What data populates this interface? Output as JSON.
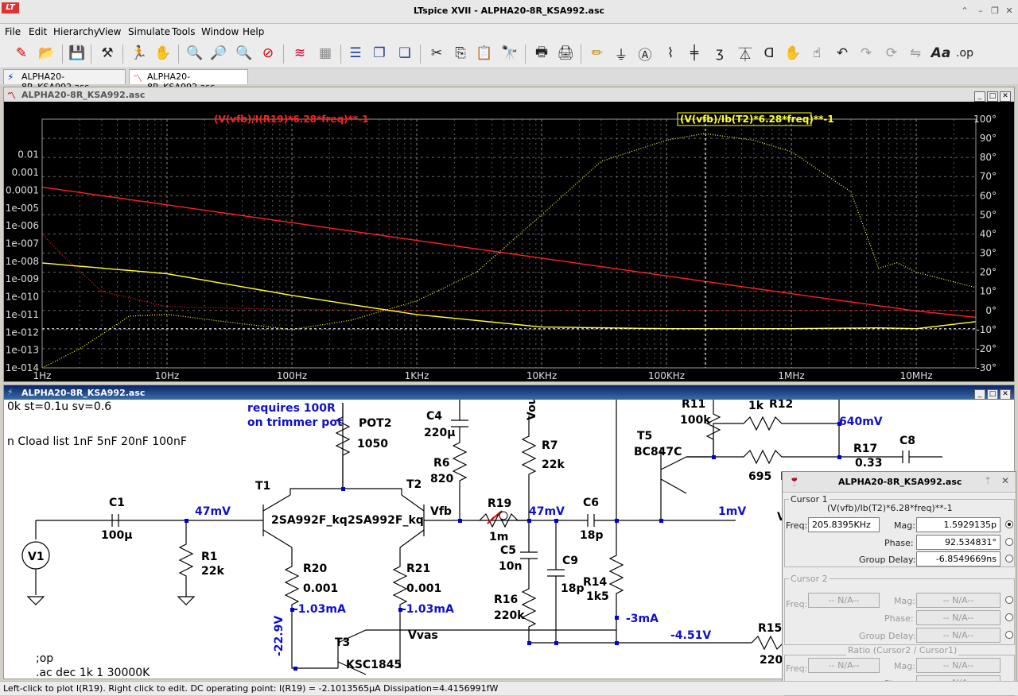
{
  "app": {
    "window_title": "LTspice XVII - ALPHA20-8R_KSA992.asc",
    "logo_text": "LT"
  },
  "menu": [
    "File",
    "Edit",
    "Hierarchy",
    "View",
    "Simulate",
    "Tools",
    "Window",
    "Help"
  ],
  "tabs": [
    {
      "label": "ALPHA20-8R_KSA992.asc",
      "icon": "schematic-icon"
    },
    {
      "label": "ALPHA20-8R_KSA992.asc",
      "icon": "waveform-icon"
    }
  ],
  "plot_window": {
    "title": "ALPHA20-8R_KSA992.asc",
    "trace1_label": "(V(vfb)/I(R19)*6.28*freq)**-1",
    "trace2_label": "(V(vfb)/Ib(T2)*6.28*freq)**-1",
    "trace1_color": "#ff2020",
    "trace2_color": "#ffff30"
  },
  "chart_data": {
    "type": "line",
    "title": "",
    "xscale": "log",
    "xlim": [
      1,
      30000000
    ],
    "xticks": [
      "1Hz",
      "10Hz",
      "100Hz",
      "1KHz",
      "10KHz",
      "100KHz",
      "1MHz",
      "10MHz"
    ],
    "yscale": "log",
    "ylim": [
      1e-14,
      1
    ],
    "yticks_left": [
      "0.01",
      "0.001",
      "0.0001",
      "1e-005",
      "1e-006",
      "1e-007",
      "1e-008",
      "1e-009",
      "1e-010",
      "1e-011",
      "1e-012",
      "1e-013",
      "1e-014"
    ],
    "yticks_left_values": [
      0.01,
      0.001,
      0.0001,
      1e-05,
      1e-06,
      1e-07,
      1e-08,
      1e-09,
      1e-10,
      1e-11,
      1e-12,
      1e-13,
      1e-14
    ],
    "y2lim": [
      -30,
      100
    ],
    "yticks_right": [
      "100°",
      "90°",
      "80°",
      "70°",
      "60°",
      "50°",
      "40°",
      "30°",
      "20°",
      "10°",
      "0°",
      "-10°",
      "-20°",
      "-30°"
    ],
    "yticks_right_values": [
      100,
      90,
      80,
      70,
      60,
      50,
      40,
      30,
      20,
      10,
      0,
      -10,
      -20,
      -30
    ],
    "grid": true,
    "cursor_x": 205839.5,
    "series": [
      {
        "name": "(V(vfb)/I(R19)*6.28*freq)**-1",
        "axis": "mag",
        "style": "solid",
        "x": [
          1,
          10,
          100,
          1000,
          10000,
          100000,
          1000000,
          10000000,
          30000000
        ],
        "values": [
          0.00015,
          1.5e-05,
          1.5e-06,
          1.5e-07,
          1.5e-08,
          1.5e-09,
          1.5e-10,
          1.6e-11,
          7e-12
        ]
      },
      {
        "name": "(V(vfb)/I(R19)*6.28*freq)**-1",
        "axis": "phase",
        "style": "dotted",
        "x": [
          1,
          1.5,
          3,
          10,
          100,
          1000,
          10000,
          1000000,
          30000000
        ],
        "values": [
          40,
          28,
          10,
          2,
          0.5,
          0,
          0,
          0,
          0
        ]
      },
      {
        "name": "(V(vfb)/Ib(T2)*6.28*freq)**-1",
        "axis": "mag",
        "style": "solid",
        "x": [
          1,
          10,
          100,
          1000,
          10000,
          100000,
          1000000,
          5000000,
          10000000,
          30000000
        ],
        "values": [
          8e-09,
          2e-09,
          1.2e-10,
          1e-11,
          2e-12,
          1.6e-12,
          1.6e-12,
          1.8e-12,
          1.6e-12,
          4e-12
        ]
      },
      {
        "name": "(V(vfb)/Ib(T2)*6.28*freq)**-1",
        "axis": "phase",
        "style": "dotted",
        "x": [
          1,
          2,
          5,
          10,
          30,
          100,
          300,
          1000,
          3000,
          10000,
          30000,
          100000,
          200000,
          500000,
          1000000,
          3000000,
          5000000,
          7000000,
          10000000,
          30000000
        ],
        "values": [
          -30,
          -20,
          -3,
          -2,
          -6,
          -10,
          -5,
          5,
          20,
          50,
          78,
          89,
          92.5,
          89,
          83,
          62,
          22,
          25,
          20,
          12
        ]
      }
    ]
  },
  "schematic_window": {
    "title": "ALPHA20-8R_KSA992.asc",
    "texts": [
      {
        "text": "0k st=0.1u sv=0.6",
        "kind": "directive"
      },
      {
        "text": "n Cload list 1nF 5nF 20nF 100nF",
        "kind": "directive"
      },
      {
        "text": "requires 100R",
        "kind": "comment"
      },
      {
        "text": "on trimmer pot",
        "kind": "comment"
      },
      {
        "text": "POT2",
        "kind": "comp"
      },
      {
        "text": "1050",
        "kind": "comp"
      },
      {
        "text": "C4",
        "kind": "comp"
      },
      {
        "text": "220µ",
        "kind": "comp"
      },
      {
        "text": "R6",
        "kind": "comp"
      },
      {
        "text": "820",
        "kind": "comp"
      },
      {
        "text": "Vout",
        "kind": "comp"
      },
      {
        "text": "R7",
        "kind": "comp"
      },
      {
        "text": "22k",
        "kind": "comp"
      },
      {
        "text": "R11",
        "kind": "comp"
      },
      {
        "text": "100k",
        "kind": "comp"
      },
      {
        "text": "1k",
        "kind": "comp"
      },
      {
        "text": "R12",
        "kind": "comp"
      },
      {
        "text": "640mV",
        "kind": "op"
      },
      {
        "text": "T5",
        "kind": "comp"
      },
      {
        "text": "BC847C",
        "kind": "comp"
      },
      {
        "text": "R17",
        "kind": "comp"
      },
      {
        "text": "C8",
        "kind": "comp"
      },
      {
        "text": "695",
        "kind": "comp"
      },
      {
        "text": "T1",
        "kind": "comp"
      },
      {
        "text": "T2",
        "kind": "comp"
      },
      {
        "text": "C1",
        "kind": "comp"
      },
      {
        "text": "47mV",
        "kind": "op"
      },
      {
        "text": "2SA992F_kq",
        "kind": "comp"
      },
      {
        "text": "2SA992F_kq",
        "kind": "comp"
      },
      {
        "text": "Vfb",
        "kind": "comp"
      },
      {
        "text": "R19",
        "kind": "comp"
      },
      {
        "text": "47mV",
        "kind": "op"
      },
      {
        "text": "C6",
        "kind": "comp"
      },
      {
        "text": "1mV",
        "kind": "op"
      },
      {
        "text": "100µ",
        "kind": "comp"
      },
      {
        "text": "V1",
        "kind": "comp"
      },
      {
        "text": "R1",
        "kind": "comp"
      },
      {
        "text": "22k",
        "kind": "comp"
      },
      {
        "text": "1m",
        "kind": "comp"
      },
      {
        "text": "18p",
        "kind": "comp"
      },
      {
        "text": "C5",
        "kind": "comp"
      },
      {
        "text": "10n",
        "kind": "comp"
      },
      {
        "text": "C9",
        "kind": "comp"
      },
      {
        "text": "R20",
        "kind": "comp"
      },
      {
        "text": "0.001",
        "kind": "comp"
      },
      {
        "text": "R21",
        "kind": "comp"
      },
      {
        "text": "0.001",
        "kind": "comp"
      },
      {
        "text": "18p",
        "kind": "comp"
      },
      {
        "text": "R14",
        "kind": "comp"
      },
      {
        "text": "1k5",
        "kind": "comp"
      },
      {
        "text": "R16",
        "kind": "comp"
      },
      {
        "text": "220k",
        "kind": "comp"
      },
      {
        "text": "-22.9V",
        "kind": "op"
      },
      {
        "text": "-1.03mA",
        "kind": "op"
      },
      {
        "text": "-1.03mA",
        "kind": "op"
      },
      {
        "text": "-3mA",
        "kind": "op"
      },
      {
        "text": "Vvas",
        "kind": "comp"
      },
      {
        "text": "-4.51V",
        "kind": "op"
      },
      {
        "text": "R15",
        "kind": "comp"
      },
      {
        "text": "T3",
        "kind": "comp"
      },
      {
        "text": ";op",
        "kind": "directive"
      },
      {
        "text": "KSC1845",
        "kind": "comp"
      },
      {
        "text": ".ac dec 1k 1 30000K",
        "kind": "directive"
      },
      {
        "text": "220",
        "kind": "comp"
      },
      {
        "text": "V",
        "kind": "comp"
      },
      {
        "text": "0.33",
        "kind": "comp"
      },
      {
        "text": "R",
        "kind": "comp"
      }
    ]
  },
  "cursor_panel": {
    "title": "ALPHA20-8R_KSA992.asc",
    "cursor1": {
      "group_label": "Cursor 1",
      "trace": "(V(vfb)/Ib(T2)*6.28*freq)**-1",
      "freq_label": "Freq:",
      "freq": "205.8395KHz",
      "mag_label": "Mag:",
      "mag": "1.5929135p",
      "phase_label": "Phase:",
      "phase": "92.534831°",
      "gd_label": "Group Delay:",
      "group_delay": "-6.8549669ns"
    },
    "cursor2": {
      "group_label": "Cursor 2",
      "freq_label": "Freq:",
      "freq": "-- N/A--",
      "mag_label": "Mag:",
      "mag": "-- N/A--",
      "phase_label": "Phase:",
      "phase": "-- N/A--",
      "gd_label": "Group Delay:",
      "group_delay": "-- N/A--"
    },
    "ratio": {
      "group_label": "Ratio (Cursor2 / Cursor1)",
      "freq_label": "Freq:",
      "freq": "-- N/A--",
      "mag_label": "Mag:",
      "mag": "-- N/A--",
      "phase_label": "Phase:",
      "phase": "-- N/A--"
    }
  },
  "status_bar": {
    "text": "Left-click to plot I(R19).  Right click to edit.  DC operating point: I(R19) = -2.1013565µA   Dissipation=4.4156991fW"
  }
}
